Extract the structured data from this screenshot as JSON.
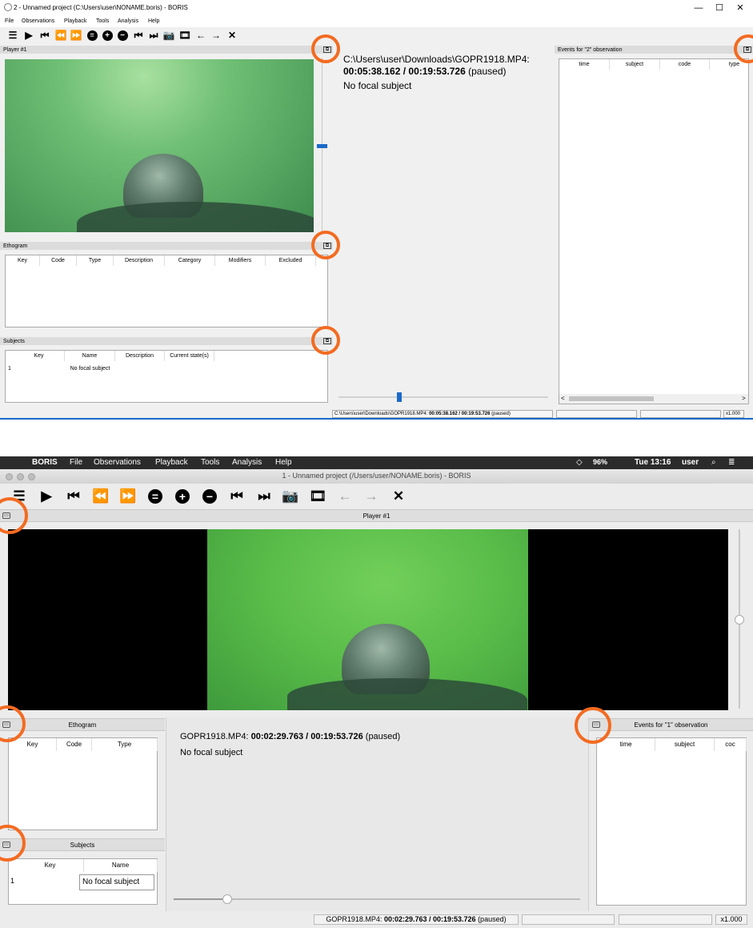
{
  "windows": {
    "title": "2 - Unnamed project (C:\\Users\\user\\NONAME.boris) - BORIS",
    "window_controls": [
      "—",
      "☐",
      "✕"
    ],
    "menu": [
      "File",
      "Observations",
      "Playback",
      "Tools",
      "Analysis",
      "Help"
    ],
    "toolbar_icons": [
      "list-icon",
      "play-icon",
      "skip-back-icon",
      "rewind-icon",
      "fast-forward-icon",
      "equal-icon",
      "plus-icon",
      "minus-icon",
      "previous-media-icon",
      "next-media-icon",
      "camera-icon",
      "film-icon",
      "arrow-left-icon",
      "arrow-right-icon",
      "close-icon"
    ],
    "player_title": "Player #1",
    "undock_glyph": "⧉",
    "info": {
      "path": "C:\\Users\\user\\Downloads\\GOPR1918.MP4:",
      "time": "00:05:38.162 / 00:19:53.726",
      "state": "(paused)",
      "focal": "No focal subject"
    },
    "ethogram": {
      "title": "Ethogram",
      "columns": [
        "Key",
        "Code",
        "Type",
        "Description",
        "Category",
        "Modifiers",
        "Excluded"
      ]
    },
    "subjects": {
      "title": "Subjects",
      "columns": [
        "Key",
        "Name",
        "Description",
        "Current state(s)"
      ],
      "rows": [
        {
          "index": "1",
          "key": "",
          "name": "No focal subject",
          "description": "",
          "state": ""
        }
      ]
    },
    "events": {
      "title": "Events for \"2\" observation",
      "columns": [
        "time",
        "subject",
        "code",
        "type"
      ]
    },
    "status": {
      "file_prefix": "C:\\Users\\user\\Downloads\\GOPR1918.MP4:",
      "time": "00:05:38.162 / 00:19:53.726",
      "state": "(paused)",
      "speed": "x1.000"
    },
    "scroll_left": "<",
    "scroll_right": ">"
  },
  "mac": {
    "apple": "",
    "app_name": "BORIS",
    "menu": [
      "File",
      "Observations",
      "Playback",
      "Tools",
      "Analysis",
      "Help"
    ],
    "tray": {
      "battery": "96%",
      "clock": "Tue 13:16",
      "user": "user"
    },
    "title": "1 - Unnamed project (/Users/user/NONAME.boris) - BORIS",
    "player_title": "Player #1",
    "info": {
      "file": "GOPR1918.MP4:",
      "time": "00:02:29.763 / 00:19:53.726",
      "state": "(paused)",
      "focal": "No focal subject"
    },
    "ethogram": {
      "title": "Ethogram",
      "columns": [
        "Key",
        "Code",
        "Type"
      ]
    },
    "subjects": {
      "title": "Subjects",
      "columns": [
        "Key",
        "Name"
      ],
      "rows": [
        {
          "index": "1",
          "key": "",
          "name": "No focal subject"
        }
      ]
    },
    "events": {
      "title": "Events for \"1\" observation",
      "columns": [
        "time",
        "subject",
        "coc"
      ]
    },
    "status": {
      "file": "GOPR1918.MP4:",
      "time": "00:02:29.763 / 00:19:53.726",
      "state": "(paused)",
      "speed": "x1.000"
    }
  },
  "colors": {
    "highlight_ring": "#f36b21",
    "accent_blue": "#1b6ac9",
    "video_green": "#6fbf76"
  }
}
